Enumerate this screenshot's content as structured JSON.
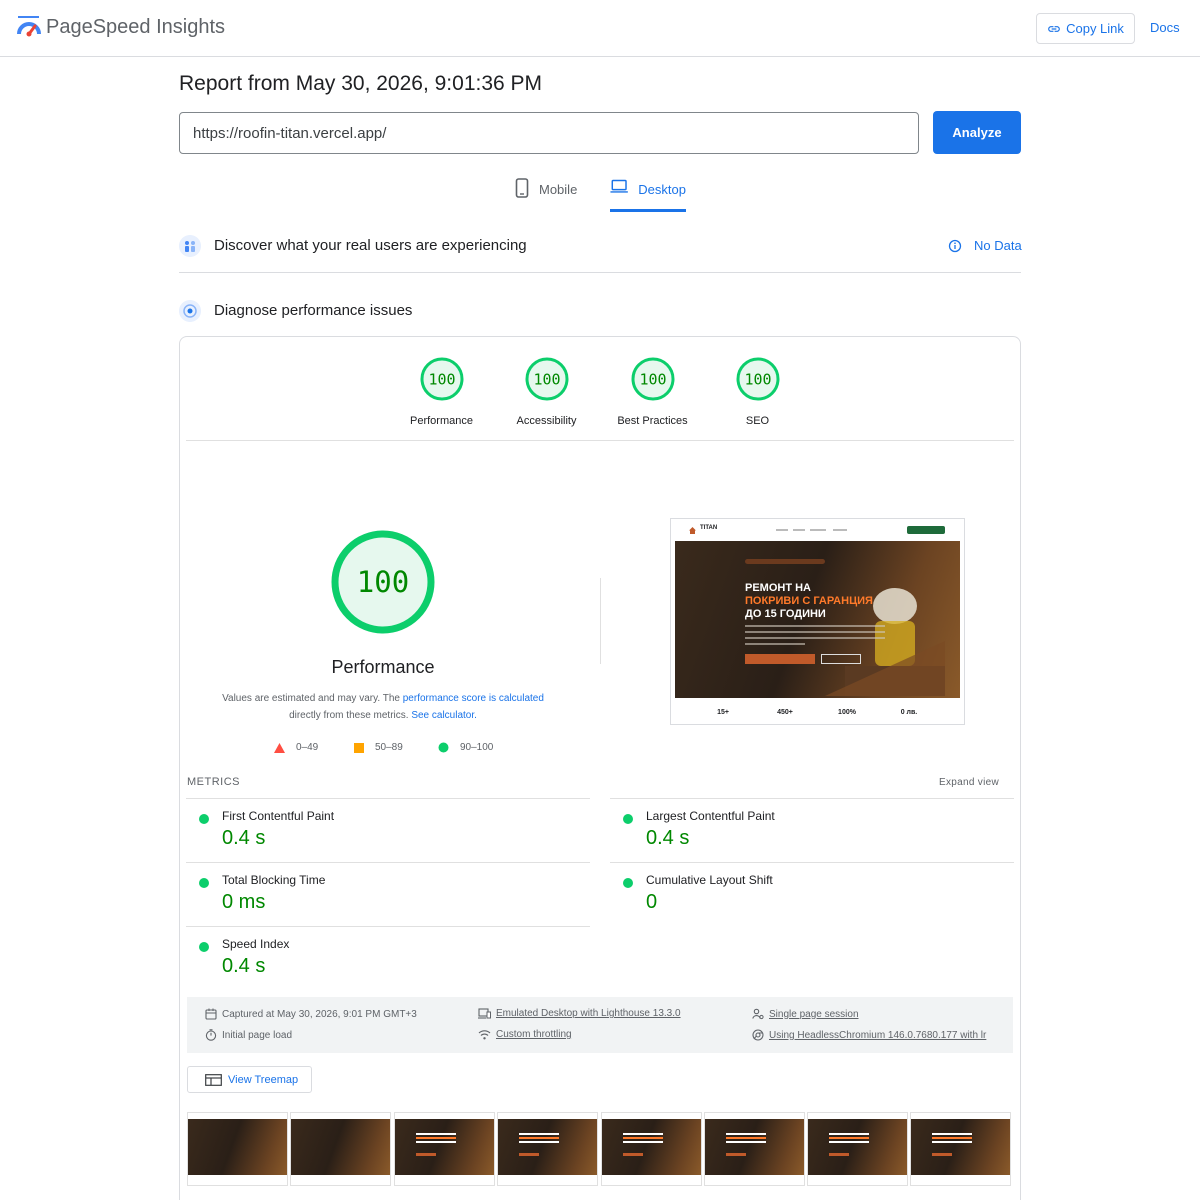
{
  "app": {
    "title": "PageSpeed Insights",
    "copy_link_label": "Copy Link",
    "docs_label": "Docs"
  },
  "report": {
    "title": "Report from May 30, 2026, 9:01:36 PM",
    "url_value": "https://roofin-titan.vercel.app/",
    "analyze_label": "Analyze"
  },
  "tabs": [
    {
      "label": "Mobile",
      "active": false
    },
    {
      "label": "Desktop",
      "active": true
    }
  ],
  "field_section": {
    "title": "Discover what your real users are experiencing",
    "status_label": "No Data"
  },
  "lab_section": {
    "title": "Diagnose performance issues"
  },
  "categories": [
    {
      "label": "Performance",
      "score": "100"
    },
    {
      "label": "Accessibility",
      "score": "100"
    },
    {
      "label": "Best Practices",
      "score": "100"
    },
    {
      "label": "SEO",
      "score": "100"
    }
  ],
  "main_gauge": {
    "score": "100",
    "label": "Performance",
    "note_prefix": "Values are estimated and may vary. The ",
    "note_link1": "performance score is calculated",
    "note_middle": "directly from these metrics. ",
    "note_link2": "See calculator."
  },
  "legend": [
    {
      "range": "0–49",
      "color": "#ff4e42",
      "shape": "triangle"
    },
    {
      "range": "50–89",
      "color": "#ffa400",
      "shape": "square"
    },
    {
      "range": "90–100",
      "color": "#0cce6b",
      "shape": "circle"
    }
  ],
  "preview": {
    "brand": "TITAN",
    "headline": [
      "РЕМОНТ НА",
      "ПОКРИВИ С ГАРАНЦИЯ",
      "ДО 15 ГОДИНИ"
    ],
    "stats": [
      "15+",
      "450+",
      "100%",
      "0 лв."
    ]
  },
  "metrics": {
    "header": "METRICS",
    "expand_label": "Expand view",
    "items": [
      {
        "name": "First Contentful Paint",
        "value": "0.4 s"
      },
      {
        "name": "Largest Contentful Paint",
        "value": "0.4 s"
      },
      {
        "name": "Total Blocking Time",
        "value": "0 ms"
      },
      {
        "name": "Cumulative Layout Shift",
        "value": "0"
      },
      {
        "name": "Speed Index",
        "value": "0.4 s"
      }
    ]
  },
  "runtime": {
    "captured": "Captured at May 30, 2026, 9:01 PM GMT+3",
    "page_load": "Initial page load",
    "emulation": "Emulated Desktop with Lighthouse 13.3.0",
    "throttling": "Custom throttling",
    "session": "Single page session",
    "browser": "Using HeadlessChromium 146.0.7680.177 with lr"
  },
  "treemap_label": "View Treemap",
  "colors": {
    "accent": "#1a73e8",
    "pass": "#0cce6b",
    "pass_text": "#008800"
  }
}
